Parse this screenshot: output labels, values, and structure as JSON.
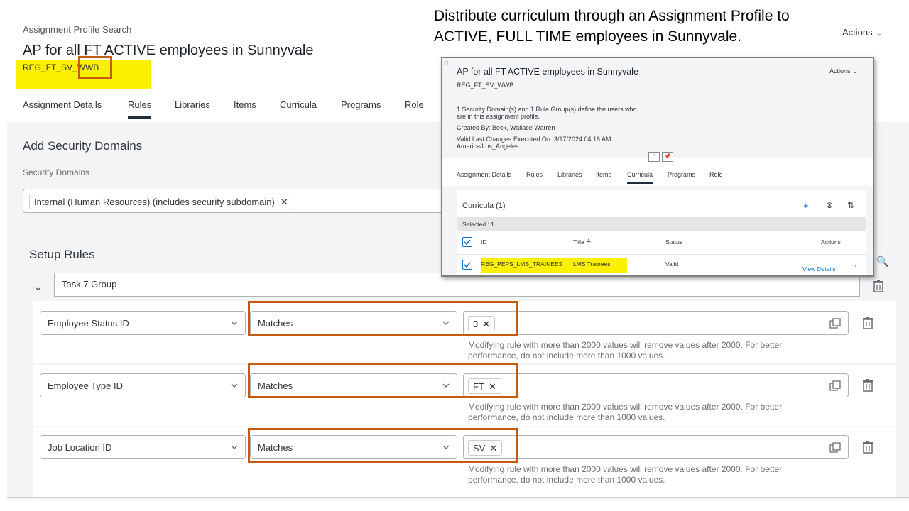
{
  "annotation": {
    "line1": "Distribute curriculum through an Assignment Profile to",
    "line2": "ACTIVE,  FULL TIME  employees in Sunnyvale."
  },
  "page": {
    "breadcrumb": "Assignment Profile Search",
    "title": "AP for all FT ACTIVE employees in Sunnyvale",
    "subtitle": "REG_FT_SV_WWB",
    "actions_label": "Actions",
    "tabs": [
      "Assignment Details",
      "Rules",
      "Libraries",
      "Items",
      "Curricula",
      "Programs",
      "Role"
    ],
    "active_tab": "Rules"
  },
  "security": {
    "section_title": "Add Security Domains",
    "field_label": "Security Domains",
    "token": "Internal (Human Resources) (includes security subdomain)"
  },
  "rules": {
    "section_title": "Setup Rules",
    "group_name": "Task 7 Group",
    "warning_line1": "Modifying rule with more than 2000 values will remove values after 2000. For better",
    "warning_line2": "performance, do not include more than 1000 values.",
    "items": [
      {
        "field": "Employee Status ID",
        "operator": "Matches",
        "value": "3"
      },
      {
        "field": "Employee Type ID",
        "operator": "Matches",
        "value": "FT"
      },
      {
        "field": "Job Location ID",
        "operator": "Matches",
        "value": "SV"
      }
    ]
  },
  "popup": {
    "title": "AP for all FT ACTIVE employees in Sunnyvale",
    "subtitle": "REG_FT_SV_WWB",
    "actions_label": "Actions",
    "info_line1": "1 Security Domain(s) and 1 Rule Group(s) define the users who",
    "info_line2": "are in this assignment profile.",
    "created_by": "Created By: Beck, Wallace Warren",
    "valid_line1": "Valid Last Changes Executed On: 3/17/2024 04:16 AM",
    "valid_line2": "America/Los_Angeles",
    "tabs": [
      "Assignment Details",
      "Rules",
      "Libraries",
      "Items",
      "Curricula",
      "Programs",
      "Role"
    ],
    "active_tab": "Curricula",
    "table_title": "Curricula (1)",
    "selected_text": "Selected : 1",
    "columns": {
      "id": "ID",
      "title": "Title",
      "status": "Status",
      "actions": "Actions"
    },
    "row": {
      "id": "REG_PEPS_LMS_TRAINEES",
      "title": "LMS Trainees",
      "status": "Valid",
      "action": "View Details"
    }
  },
  "colors": {
    "highlight": "#fcf000",
    "annotation_box": "#c55a11",
    "link": "#0a6ed1"
  }
}
